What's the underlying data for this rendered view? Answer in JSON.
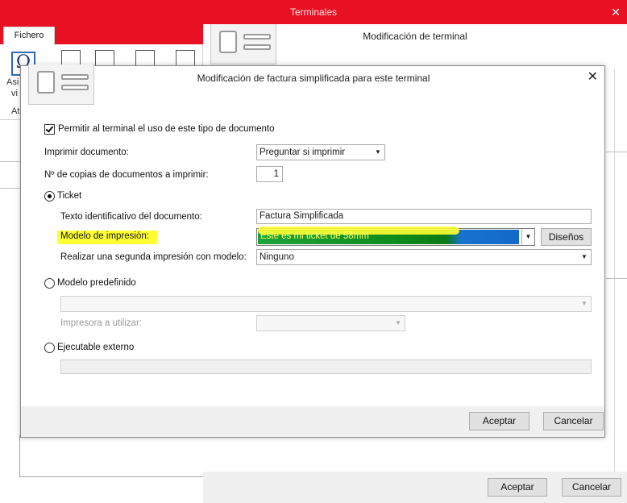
{
  "app": {
    "window_title": "Terminales",
    "tab": "Fichero",
    "ribbon_partial_labels": [
      "Asi",
      "vi",
      "At"
    ],
    "background_dialog_title": "Modificación de terminal",
    "background_accept": "Aceptar",
    "background_cancel": "Cancelar"
  },
  "dialog": {
    "title": "Modificación de factura simplificada para este terminal",
    "allow_checkbox_label": "Permitir al terminal el uso de este tipo de documento",
    "allow_checked": true,
    "print_doc_label": "Imprimir documento:",
    "print_doc_value": "Preguntar si imprimir",
    "copies_label": "Nº de copias de documentos a imprimir:",
    "copies_value": "1",
    "ticket_label": "Ticket",
    "doc_text_label": "Texto identificativo del documento:",
    "doc_text_value": "Factura Simplificada",
    "print_model_label": "Modelo de impresión:",
    "print_model_value": "Este es mi ticket de 58mm",
    "designs_button": "Diseños",
    "second_print_label": "Realizar una segunda impresión con modelo:",
    "second_print_value": "Ninguno",
    "predefined_model_label": "Modelo predefinido",
    "printer_label": "Impresora a utilizar:",
    "external_exec_label": "Ejecutable externo",
    "accept_button": "Aceptar",
    "cancel_button": "Cancelar"
  }
}
